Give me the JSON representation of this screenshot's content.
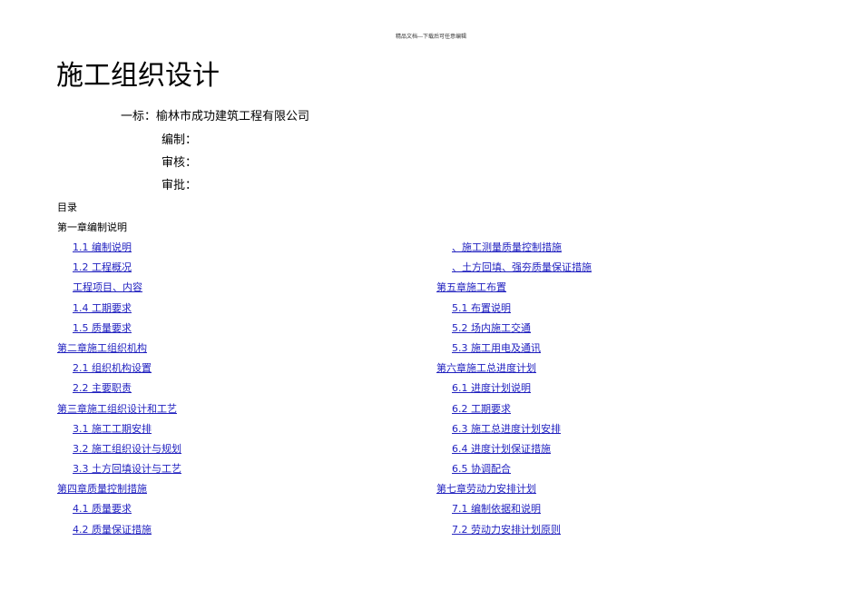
{
  "header_note": "精品文档---下载后可任意编辑",
  "title": "施工组织设计",
  "bid_line": "一标：榆林市成功建筑工程有限公司",
  "fields": [
    "编制：",
    "审核：",
    "审批："
  ],
  "toc_heading": "目录",
  "first_chapter": "第一章编制说明",
  "toc_left": [
    {
      "level": 2,
      "text": "1.1  编制说明"
    },
    {
      "level": 2,
      "text": "1.2  工程概况"
    },
    {
      "level": 2,
      "text": "工程项目、内容"
    },
    {
      "level": 2,
      "text": "1.4  工期要求"
    },
    {
      "level": 2,
      "text": "1.5  质量要求"
    },
    {
      "level": 1,
      "text": "第二章施工组织机构"
    },
    {
      "level": 2,
      "text": "2.1  组织机构设置"
    },
    {
      "level": 2,
      "text": "2.2  主要职责"
    },
    {
      "level": 1,
      "text": "第三章施工组织设计和工艺"
    },
    {
      "level": 2,
      "text": "3.1  施工工期安排"
    },
    {
      "level": 2,
      "text": "3.2  施工组织设计与规划"
    },
    {
      "level": 2,
      "text": "3.3  土方回填设计与工艺"
    },
    {
      "level": 1,
      "text": "第四章质量控制措施"
    },
    {
      "level": 2,
      "text": "4.1  质量要求"
    },
    {
      "level": 2,
      "text": "4.2  质量保证措施"
    }
  ],
  "toc_right": [
    {
      "level": 2,
      "text": "、施工测量质量控制措施"
    },
    {
      "level": 2,
      "text": "、土方回填、强夯质量保证措施"
    },
    {
      "level": 1,
      "text": "第五章施工布置"
    },
    {
      "level": 2,
      "text": "5.1  布置说明"
    },
    {
      "level": 2,
      "text": "5.2  场内施工交通"
    },
    {
      "level": 2,
      "text": "5.3  施工用电及通讯"
    },
    {
      "level": 1,
      "text": "第六章施工总进度计划"
    },
    {
      "level": 2,
      "text": "6.1  进度计划说明"
    },
    {
      "level": 2,
      "text": "6.2  工期要求"
    },
    {
      "level": 2,
      "text": "6.3  施工总进度计划安排"
    },
    {
      "level": 2,
      "text": "6.4  进度计划保证措施"
    },
    {
      "level": 2,
      "text": "6.5  协调配合"
    },
    {
      "level": 1,
      "text": "第七章劳动力安排计划"
    },
    {
      "level": 2,
      "text": "7.1  编制依据和说明"
    },
    {
      "level": 2,
      "text": "7.2  劳动力安排计划原则"
    }
  ]
}
